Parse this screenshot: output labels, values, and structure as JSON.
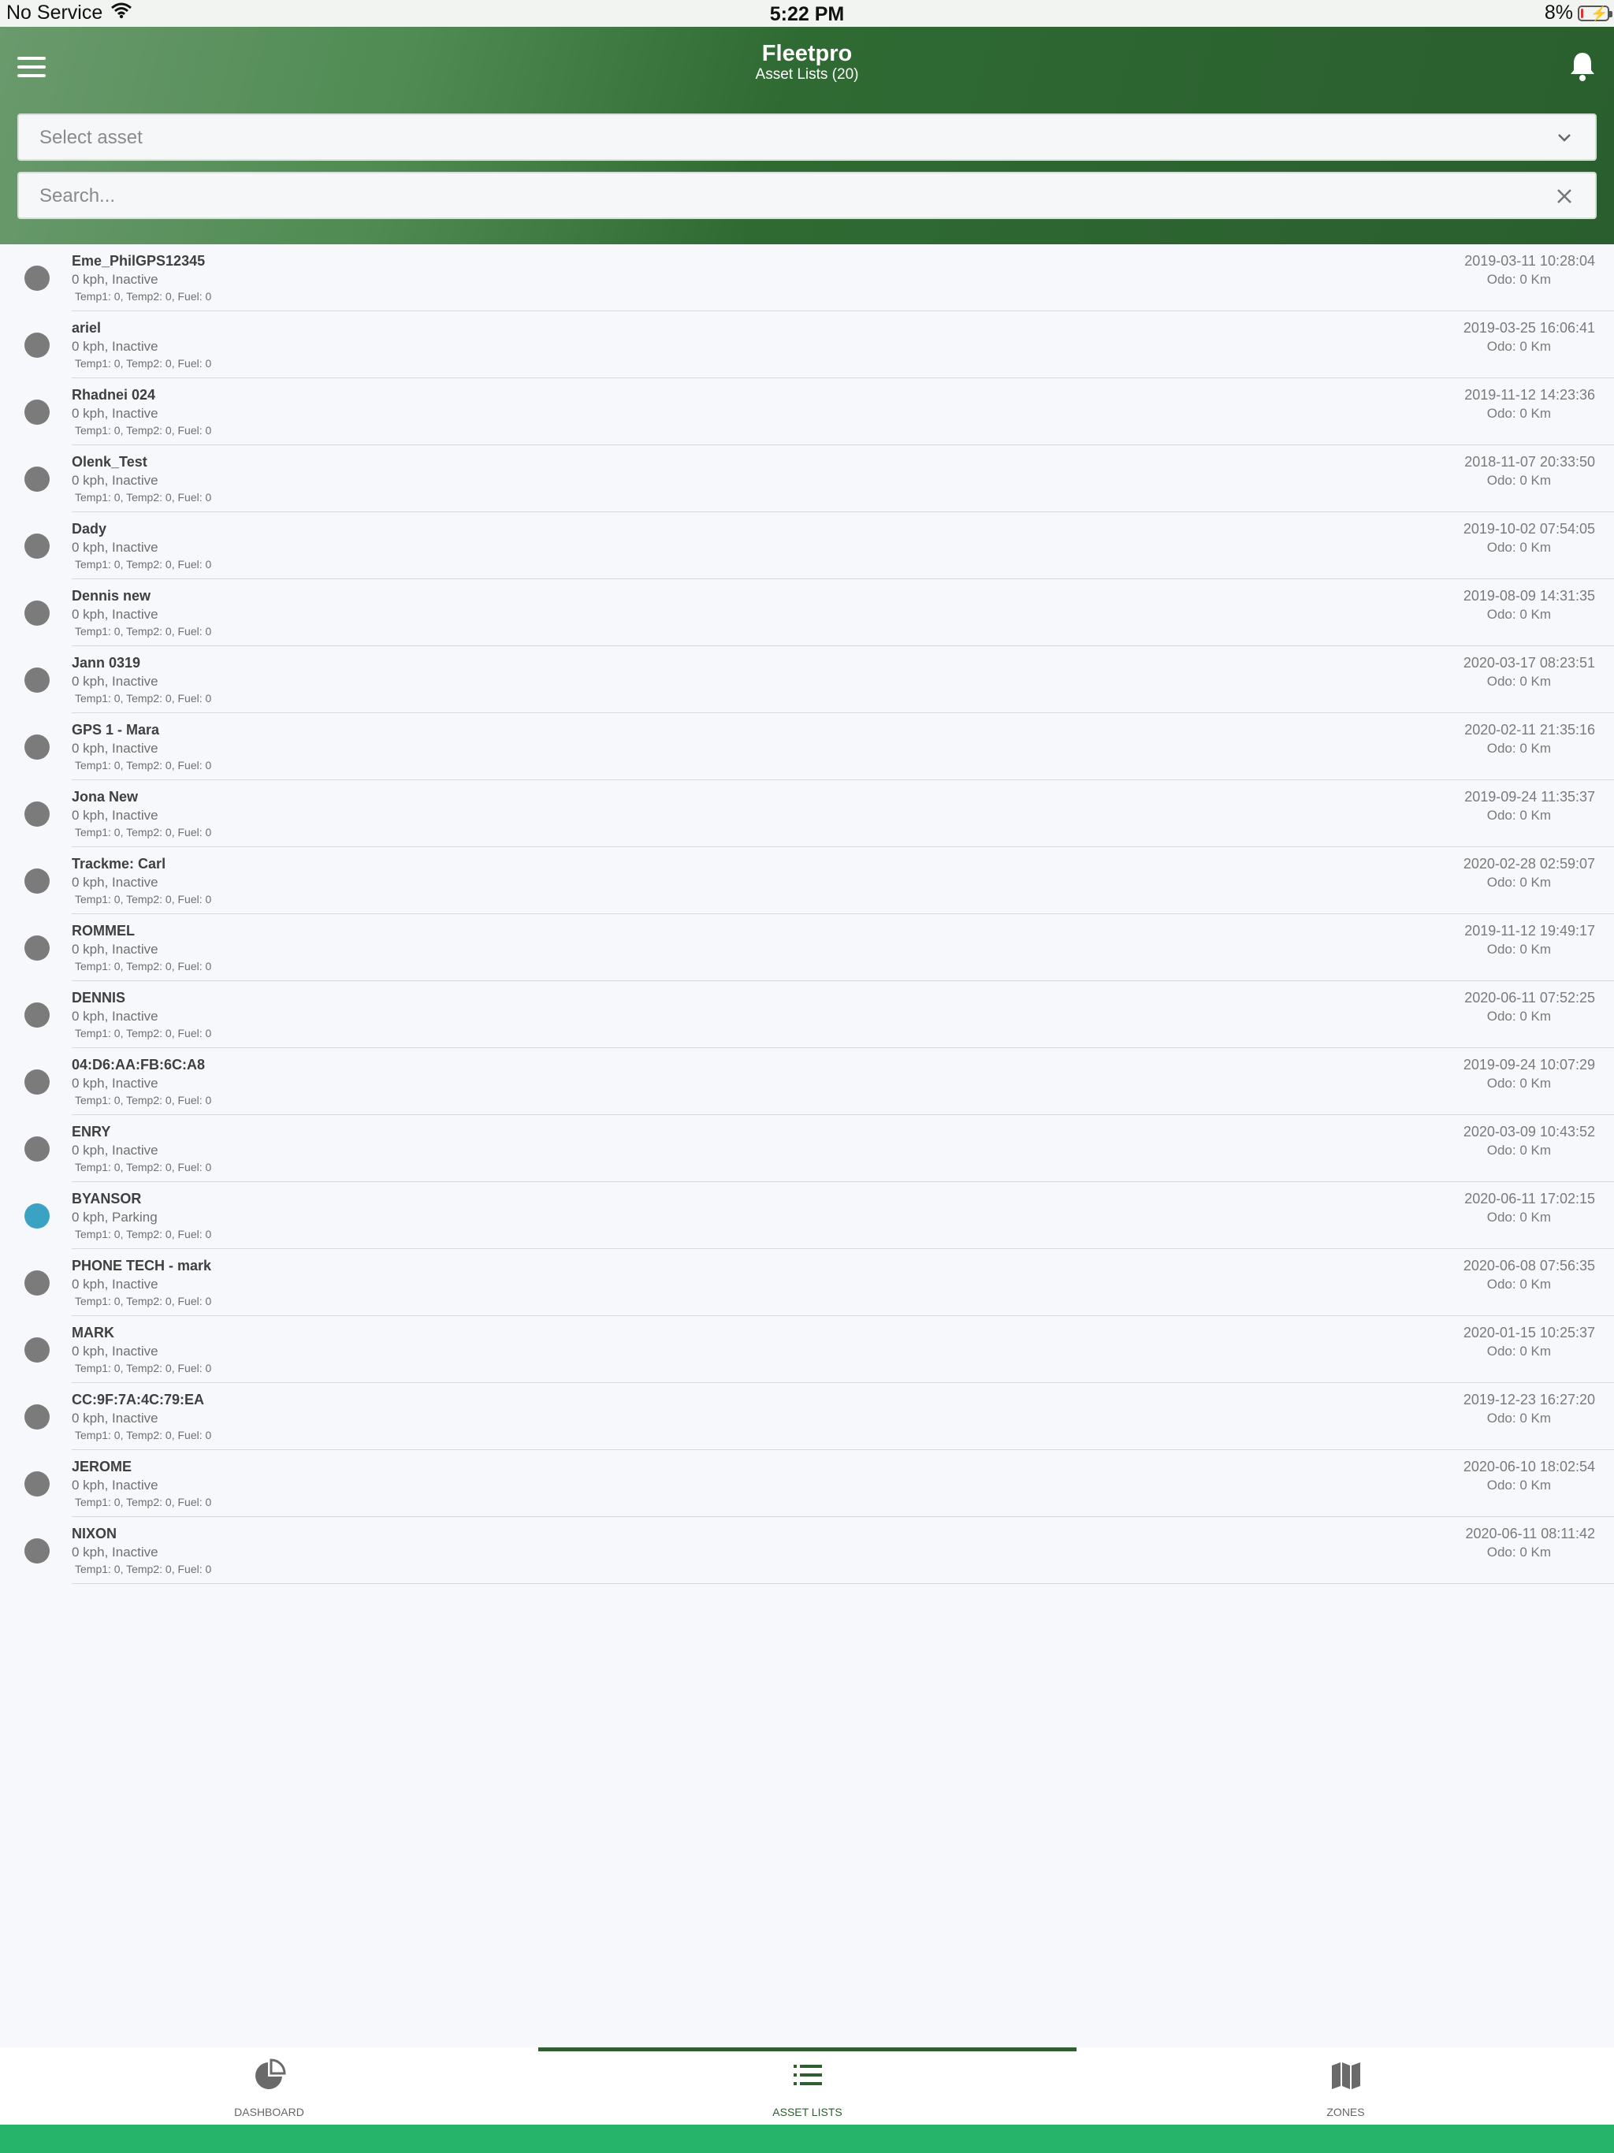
{
  "status_bar": {
    "carrier": "No Service",
    "time": "5:22 PM",
    "battery": "8%",
    "battery_level": 0.08
  },
  "header": {
    "title": "Fleetpro",
    "subtitle": "Asset Lists (20)"
  },
  "select_asset": {
    "placeholder": "Select asset"
  },
  "search": {
    "placeholder": "Search..."
  },
  "colors": {
    "inactive": "#7b7b7b",
    "parking": "#3aa3c4",
    "header_dark": "#2a5e2e",
    "accent": "#26b36a"
  },
  "assets": [
    {
      "name": "Eme_PhilGPS12345",
      "status": "0 kph, Inactive",
      "temps": "Temp1: 0, Temp2: 0, Fuel: 0",
      "date": "2019-03-11 10:28:04",
      "odo": "Odo: 0 Km",
      "state": "inactive"
    },
    {
      "name": "ariel",
      "status": "0 kph, Inactive",
      "temps": "Temp1: 0, Temp2: 0, Fuel: 0",
      "date": "2019-03-25 16:06:41",
      "odo": "Odo: 0 Km",
      "state": "inactive"
    },
    {
      "name": "Rhadnei 024",
      "status": "0 kph, Inactive",
      "temps": "Temp1: 0, Temp2: 0, Fuel: 0",
      "date": "2019-11-12 14:23:36",
      "odo": "Odo: 0 Km",
      "state": "inactive"
    },
    {
      "name": "Olenk_Test",
      "status": "0 kph, Inactive",
      "temps": "Temp1: 0, Temp2: 0, Fuel: 0",
      "date": "2018-11-07 20:33:50",
      "odo": "Odo: 0 Km",
      "state": "inactive"
    },
    {
      "name": "Dady",
      "status": "0 kph, Inactive",
      "temps": "Temp1: 0, Temp2: 0, Fuel: 0",
      "date": "2019-10-02 07:54:05",
      "odo": "Odo: 0 Km",
      "state": "inactive"
    },
    {
      "name": "Dennis new",
      "status": "0 kph, Inactive",
      "temps": "Temp1: 0, Temp2: 0, Fuel: 0",
      "date": "2019-08-09 14:31:35",
      "odo": "Odo: 0 Km",
      "state": "inactive"
    },
    {
      "name": "Jann 0319",
      "status": "0 kph, Inactive",
      "temps": "Temp1: 0, Temp2: 0, Fuel: 0",
      "date": "2020-03-17 08:23:51",
      "odo": "Odo: 0 Km",
      "state": "inactive"
    },
    {
      "name": "GPS 1 - Mara",
      "status": "0 kph, Inactive",
      "temps": "Temp1: 0, Temp2: 0, Fuel: 0",
      "date": "2020-02-11 21:35:16",
      "odo": "Odo: 0 Km",
      "state": "inactive"
    },
    {
      "name": "Jona New",
      "status": "0 kph, Inactive",
      "temps": "Temp1: 0, Temp2: 0, Fuel: 0",
      "date": "2019-09-24 11:35:37",
      "odo": "Odo: 0 Km",
      "state": "inactive"
    },
    {
      "name": "Trackme: Carl",
      "status": "0 kph, Inactive",
      "temps": "Temp1: 0, Temp2: 0, Fuel: 0",
      "date": "2020-02-28 02:59:07",
      "odo": "Odo: 0 Km",
      "state": "inactive"
    },
    {
      "name": "ROMMEL",
      "status": "0 kph, Inactive",
      "temps": "Temp1: 0, Temp2: 0, Fuel: 0",
      "date": "2019-11-12 19:49:17",
      "odo": "Odo: 0 Km",
      "state": "inactive"
    },
    {
      "name": "DENNIS",
      "status": "0 kph, Inactive",
      "temps": "Temp1: 0, Temp2: 0, Fuel: 0",
      "date": "2020-06-11 07:52:25",
      "odo": "Odo: 0 Km",
      "state": "inactive"
    },
    {
      "name": "04:D6:AA:FB:6C:A8",
      "status": "0 kph, Inactive",
      "temps": "Temp1: 0, Temp2: 0, Fuel: 0",
      "date": "2019-09-24 10:07:29",
      "odo": "Odo: 0 Km",
      "state": "inactive"
    },
    {
      "name": "ENRY",
      "status": "0 kph, Inactive",
      "temps": "Temp1: 0, Temp2: 0, Fuel: 0",
      "date": "2020-03-09 10:43:52",
      "odo": "Odo: 0 Km",
      "state": "inactive"
    },
    {
      "name": "BYANSOR",
      "status": "0 kph, Parking",
      "temps": "Temp1: 0, Temp2: 0, Fuel: 0",
      "date": "2020-06-11 17:02:15",
      "odo": "Odo: 0 Km",
      "state": "parking"
    },
    {
      "name": "PHONE TECH - mark",
      "status": "0 kph, Inactive",
      "temps": "Temp1: 0, Temp2: 0, Fuel: 0",
      "date": "2020-06-08 07:56:35",
      "odo": "Odo: 0 Km",
      "state": "inactive"
    },
    {
      "name": "MARK",
      "status": "0 kph, Inactive",
      "temps": "Temp1: 0, Temp2: 0, Fuel: 0",
      "date": "2020-01-15 10:25:37",
      "odo": "Odo: 0 Km",
      "state": "inactive"
    },
    {
      "name": "CC:9F:7A:4C:79:EA",
      "status": "0 kph, Inactive",
      "temps": "Temp1: 0, Temp2: 0, Fuel: 0",
      "date": "2019-12-23 16:27:20",
      "odo": "Odo: 0 Km",
      "state": "inactive"
    },
    {
      "name": "JEROME",
      "status": "0 kph, Inactive",
      "temps": "Temp1: 0, Temp2: 0, Fuel: 0",
      "date": "2020-06-10 18:02:54",
      "odo": "Odo: 0 Km",
      "state": "inactive"
    },
    {
      "name": "NIXON",
      "status": "0 kph, Inactive",
      "temps": "Temp1: 0, Temp2: 0, Fuel: 0",
      "date": "2020-06-11 08:11:42",
      "odo": "Odo: 0 Km",
      "state": "inactive"
    }
  ],
  "tabs": [
    {
      "label": "DASHBOARD",
      "icon": "pie-chart-icon",
      "active": false
    },
    {
      "label": "ASSET LISTS",
      "icon": "list-icon",
      "active": true
    },
    {
      "label": "ZONES",
      "icon": "map-icon",
      "active": false
    }
  ]
}
